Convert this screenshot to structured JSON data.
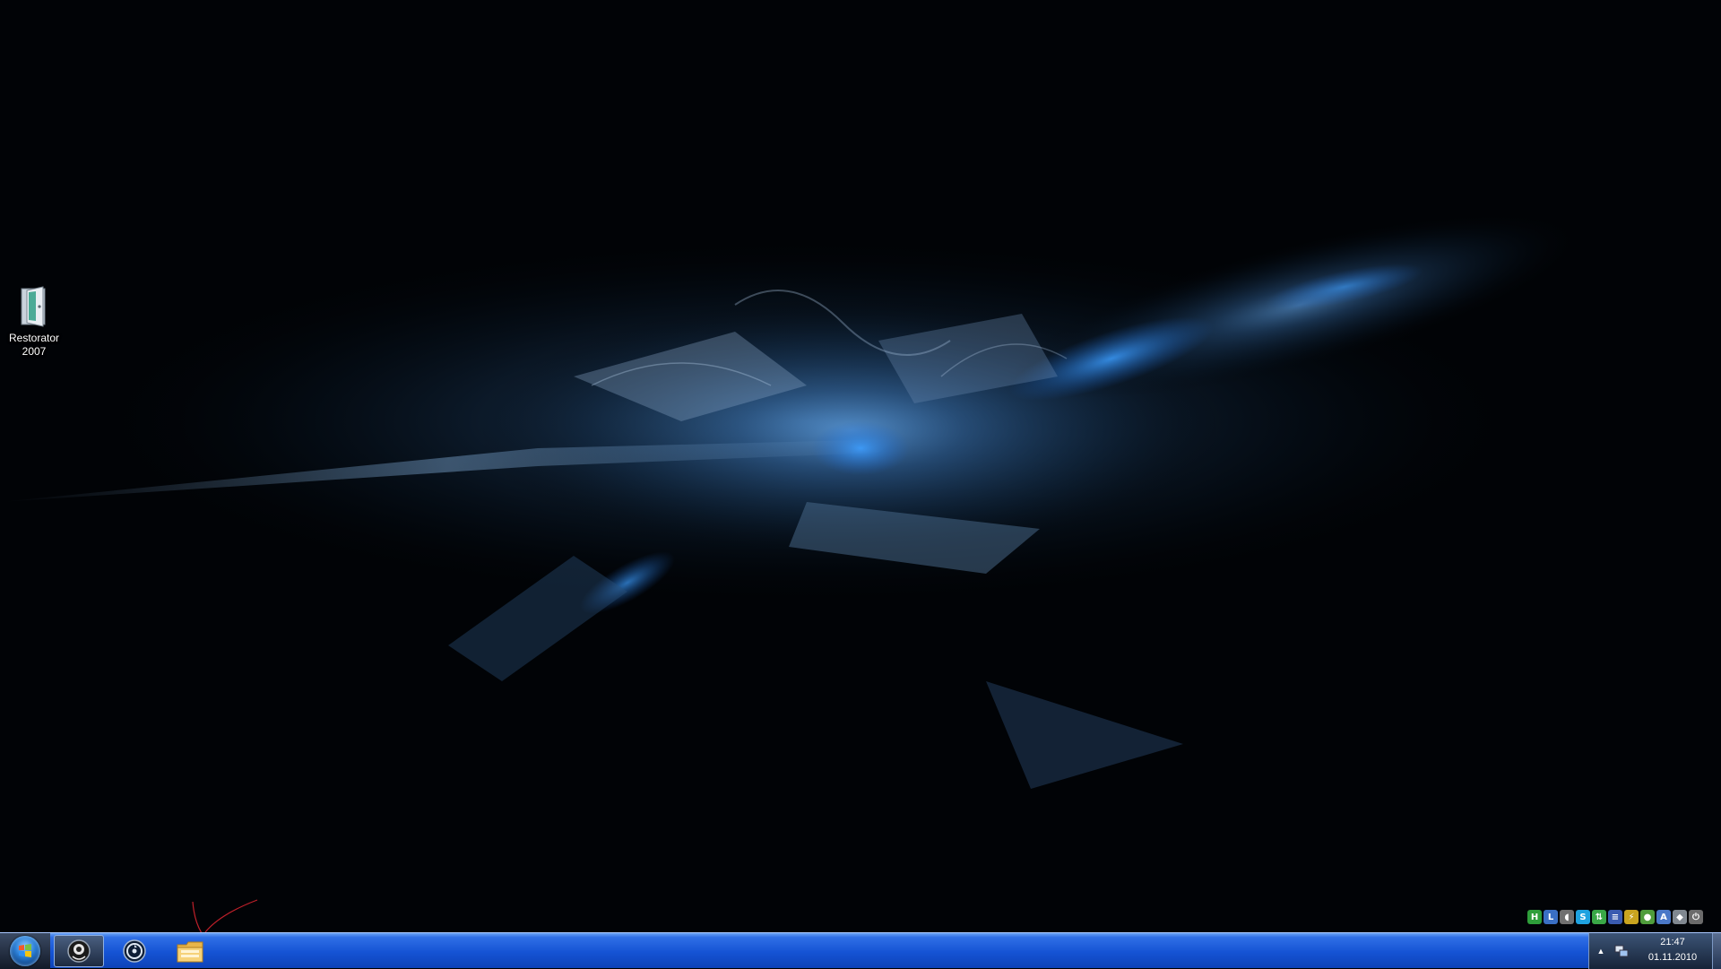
{
  "desktop": {
    "icons": [
      {
        "label": "Restorator\n2007",
        "icon": "restorator-door-icon"
      }
    ]
  },
  "taskbar": {
    "start": {
      "icon": "windows-orb-icon"
    },
    "buttons": [
      {
        "name": "media-player-icon",
        "active": true
      },
      {
        "name": "sync-app-icon",
        "active": false
      },
      {
        "name": "file-explorer-icon",
        "active": false
      }
    ],
    "tray_overflow": [
      {
        "icon": "h-app-icon",
        "glyph": "H",
        "color": "#2e9e3a"
      },
      {
        "icon": "window-app-icon",
        "glyph": "L",
        "color": "#3a6fc4"
      },
      {
        "icon": "speaker-icon",
        "glyph": "◖",
        "color": "#707070"
      },
      {
        "icon": "skype-icon",
        "glyph": "S",
        "color": "#1fa2e0"
      },
      {
        "icon": "sync-green-icon",
        "glyph": "⇅",
        "color": "#3aa847"
      },
      {
        "icon": "language-flag-icon",
        "glyph": "≡",
        "color": "#3a5bb0"
      },
      {
        "icon": "download-icon",
        "glyph": "⚡",
        "color": "#c9a41f"
      },
      {
        "icon": "shield-green-icon",
        "glyph": "●",
        "color": "#4f9d3c"
      },
      {
        "icon": "antivirus-icon",
        "glyph": "A",
        "color": "#4a78c8"
      },
      {
        "icon": "security-shield-icon",
        "glyph": "◆",
        "color": "#808890"
      },
      {
        "icon": "power-icon",
        "glyph": "⏻",
        "color": "#6b6b6b"
      }
    ],
    "clock": {
      "time": "21:47",
      "date": "01.11.2010"
    },
    "colors": {
      "bar": "#1553d4",
      "accent": "#6aa3f5"
    }
  }
}
